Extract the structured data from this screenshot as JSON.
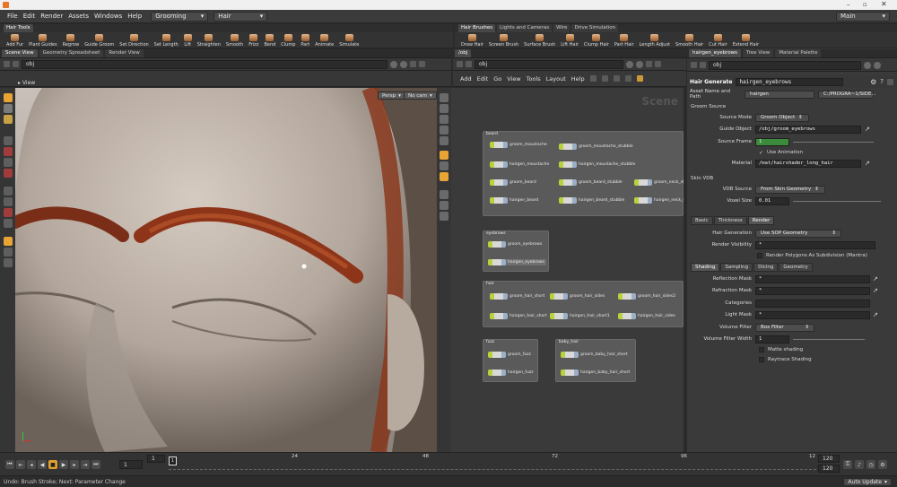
{
  "menubar": {
    "items": [
      "File",
      "Edit",
      "Render",
      "Assets",
      "Windows",
      "Help"
    ],
    "desktop": "Grooming",
    "context": "Hair",
    "workspace": "Main"
  },
  "shelf_left": {
    "tab": "Hair Tools",
    "tools": [
      "Add Fur",
      "Plant Guides",
      "Regrow",
      "Guide Groom",
      "Set Direction",
      "Set Length",
      "Lift",
      "Straighten",
      "Smooth",
      "Frizz",
      "Bend",
      "Clump",
      "Part",
      "Animate",
      "Simulate"
    ]
  },
  "shelf_right": {
    "tabs": [
      "Hair Brushes",
      "Lights and Cameras",
      "Wire",
      "Drive Simulation"
    ],
    "tools": [
      "Draw Hair",
      "Screen Brush",
      "Surface Brush",
      "Lift Hair",
      "Clump Hair",
      "Part Hair",
      "Length Adjust",
      "Smooth Hair",
      "Cut Hair",
      "Extend Hair"
    ]
  },
  "left_pane": {
    "tabs": [
      "Scene View",
      "Geometry Spreadsheet",
      "Render View"
    ],
    "path": "obj",
    "view_label": "View",
    "camera": "Persp",
    "cam_mode": "No cam"
  },
  "network": {
    "tab": "/obj",
    "path": "obj",
    "menu": [
      "Add",
      "Edit",
      "Go",
      "View",
      "Tools",
      "Layout",
      "Help"
    ],
    "watermark": "Scene",
    "boxes": [
      {
        "label": "beard",
        "nodes": [
          "groom_moustache",
          "groom_moustache_stubble",
          "hairgen_moustache",
          "hairgen_moustache_stubble",
          "groom_beard",
          "groom_beard_stubble",
          "groom_neck_stubble",
          "hairgen_beard",
          "hairgen_beard_stubble",
          "hairgen_neck_stubble"
        ]
      },
      {
        "label": "eyebrows",
        "nodes": [
          "groom_eyebrows",
          "hairgen_eyebrows"
        ]
      },
      {
        "label": "hair",
        "nodes": [
          "groom_hair_short",
          "groom_hair_sides",
          "groom_hair_sides2",
          "hairgen_hair_short",
          "hairgen_hair_short1",
          "hairgen_hair_sides"
        ]
      },
      {
        "label": "fuzz",
        "nodes": [
          "groom_fuzz",
          "hairgen_fuzz"
        ]
      },
      {
        "label": "baby_hair",
        "nodes": [
          "groom_baby_hair_short",
          "hairgen_baby_hair_short"
        ]
      }
    ]
  },
  "params": {
    "tabs": [
      "hairgen_eyebrows",
      "Tree View",
      "Material Palette"
    ],
    "path": "obj",
    "node_type": "Hair Generate",
    "node_name": "hairgen_eyebrows",
    "asset_label": "Asset Name and Path",
    "asset_name": "hairgen",
    "asset_path": "C:/PROGRA~1/SIDE...",
    "groom_source": "Groom Source",
    "source_mode_label": "Source Mode",
    "source_mode": "Groom Object",
    "guide_label": "Guide Object",
    "guide_value": "/obj/groom_eyebrows",
    "frame_label": "Source Frame",
    "frame_value": "1",
    "use_animation": "Use Animation",
    "material_label": "Material",
    "material_value": "/mat/hairshader_long_hair",
    "skin_vdb": "Skin VDB",
    "vdb_label": "VDB Source",
    "vdb_value": "From Skin Geometry",
    "voxel_label": "Voxel Size",
    "voxel_value": "0.01",
    "tabs2": [
      "Basic",
      "Thickness",
      "Render"
    ],
    "hairgen_label": "Hair Generation",
    "hairgen_value": "Use SOP Geometry",
    "render_vis_label": "Render Visibility",
    "render_vis_value": "*",
    "render_poly": "Render Polygons As Subdivision (Mantra)",
    "tabs3": [
      "Shading",
      "Sampling",
      "Dicing",
      "Geometry"
    ],
    "refl_label": "Reflection Mask",
    "refl_value": "*",
    "refr_label": "Refraction Mask",
    "refr_value": "*",
    "cat_label": "Categories",
    "light_label": "Light Mask",
    "light_value": "*",
    "vf_label": "Volume Filter",
    "vf_value": "Box Filter",
    "vfw_label": "Volume Filter Width",
    "vfw_value": "1",
    "matte": "Matte shading",
    "raytrace": "Raytrace Shading"
  },
  "timeline": {
    "frame": "1",
    "start": "1",
    "ticks": [
      "24",
      "48",
      "72",
      "96"
    ],
    "end_a": "120",
    "end_b": "120",
    "current_tick": "1",
    "last_tick": "12"
  },
  "status": {
    "text": "Undo: Brush Stroke; Next: Parameter Change",
    "auto_update": "Auto Update"
  }
}
